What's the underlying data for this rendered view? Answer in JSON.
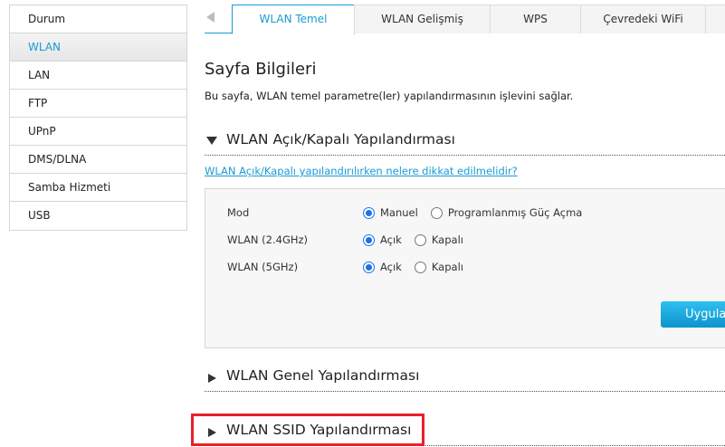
{
  "sidebar": {
    "items": [
      {
        "label": "Durum",
        "active": false
      },
      {
        "label": "WLAN",
        "active": true
      },
      {
        "label": "LAN",
        "active": false
      },
      {
        "label": "FTP",
        "active": false
      },
      {
        "label": "UPnP",
        "active": false
      },
      {
        "label": "DMS/DLNA",
        "active": false
      },
      {
        "label": "Samba Hizmeti",
        "active": false
      },
      {
        "label": "USB",
        "active": false
      }
    ]
  },
  "tabs": [
    {
      "label": "WLAN Temel",
      "active": true
    },
    {
      "label": "WLAN Gelişmiş",
      "active": false
    },
    {
      "label": "WPS",
      "active": false
    },
    {
      "label": "Çevredeki WiFi",
      "active": false
    },
    {
      "label": "",
      "active": false
    }
  ],
  "page": {
    "title": "Sayfa Bilgileri",
    "description": "Bu sayfa, WLAN temel parametre(ler) yapılandırmasının işlevini sağlar."
  },
  "section_onoff": {
    "title": "WLAN Açık/Kapalı Yapılandırması",
    "expanded": true,
    "help_link": "WLAN Açık/Kapalı yapılandırılırken nelere dikkat edilmelidir?",
    "rows": [
      {
        "label": "Mod",
        "options": [
          "Manuel",
          "Programlanmış Güç Açma"
        ],
        "selected": 0
      },
      {
        "label": "WLAN (2.4GHz)",
        "options": [
          "Açık",
          "Kapalı"
        ],
        "selected": 0
      },
      {
        "label": "WLAN (5GHz)",
        "options": [
          "Açık",
          "Kapalı"
        ],
        "selected": 0
      }
    ],
    "apply_label": "Uygula"
  },
  "section_general": {
    "title": "WLAN Genel Yapılandırması",
    "expanded": false
  },
  "section_ssid": {
    "title": "WLAN SSID Yapılandırması",
    "expanded": false,
    "highlighted": true
  },
  "colors": {
    "accent": "#1a9ad6",
    "highlight": "#e8202a",
    "radio": "#1a73e8"
  }
}
